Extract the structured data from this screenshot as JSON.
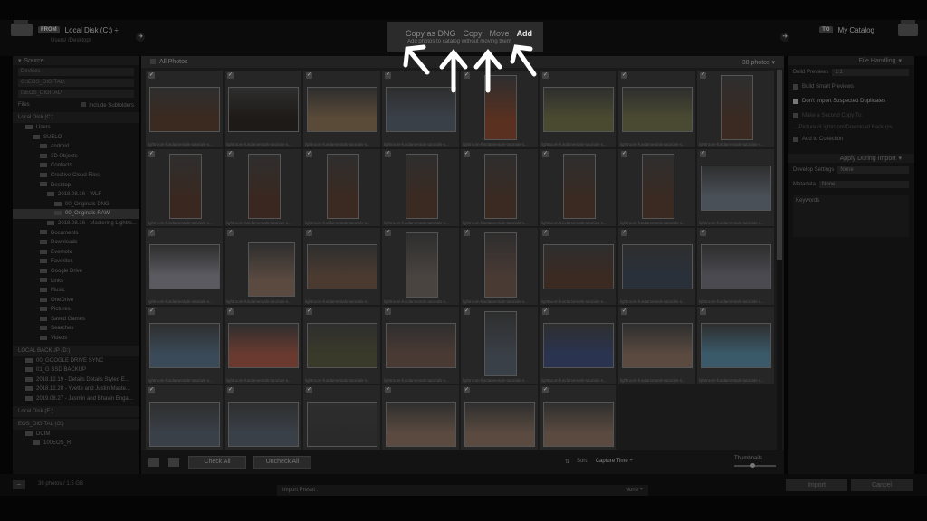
{
  "header": {
    "from_badge": "FROM",
    "from_location": "Local Disk (C:) ÷",
    "from_subpath": "Users/ /Desktop/",
    "import_modes": [
      "Copy as DNG",
      "Copy",
      "Move",
      "Add"
    ],
    "active_mode": "Add",
    "mode_description": "Add photos to catalog without moving them",
    "to_badge": "TO",
    "to_location": "My Catalog"
  },
  "source_panel": {
    "title": "Source",
    "fields": [
      "Devices",
      "G:\\EOS_DIGITAL\\",
      "I:\\EOS_DIGITAL\\"
    ],
    "files_label": "Files",
    "include_subfolders": "Include Subfolders",
    "tree": [
      {
        "label": "Local Disk (C:)",
        "type": "volume"
      },
      {
        "label": "Users",
        "type": "folder",
        "indent": 1
      },
      {
        "label": "SUELO",
        "type": "folder",
        "indent": 2
      },
      {
        "label": "android",
        "type": "folder",
        "indent": 3
      },
      {
        "label": "3D Objects",
        "type": "folder",
        "indent": 3
      },
      {
        "label": "Contacts",
        "type": "folder",
        "indent": 3
      },
      {
        "label": "Creative Cloud Files",
        "type": "folder",
        "indent": 3
      },
      {
        "label": "Desktop",
        "type": "folder",
        "indent": 3
      },
      {
        "label": "2018.08.16 - WLF",
        "type": "folder",
        "indent": 4
      },
      {
        "label": "00_Originals DNG",
        "type": "folder",
        "indent": 5
      },
      {
        "label": "00_Originals RAW",
        "type": "folder",
        "indent": 5,
        "selected": true
      },
      {
        "label": "2018.08.16 - Mastering Lightro...",
        "type": "folder",
        "indent": 4
      },
      {
        "label": "Documents",
        "type": "folder",
        "indent": 3
      },
      {
        "label": "Downloads",
        "type": "folder",
        "indent": 3
      },
      {
        "label": "Evernote",
        "type": "folder",
        "indent": 3
      },
      {
        "label": "Favorites",
        "type": "folder",
        "indent": 3
      },
      {
        "label": "Google Drive",
        "type": "folder",
        "indent": 3
      },
      {
        "label": "Links",
        "type": "folder",
        "indent": 3
      },
      {
        "label": "Music",
        "type": "folder",
        "indent": 3
      },
      {
        "label": "OneDrive",
        "type": "folder",
        "indent": 3
      },
      {
        "label": "Pictures",
        "type": "folder",
        "indent": 3
      },
      {
        "label": "Saved Games",
        "type": "folder",
        "indent": 3
      },
      {
        "label": "Searches",
        "type": "folder",
        "indent": 3
      },
      {
        "label": "Videos",
        "type": "folder",
        "indent": 3
      },
      {
        "label": "LOCAL BACKUP (D:)",
        "type": "volume"
      },
      {
        "label": "00_GOOGLE DRIVE SYNC",
        "type": "folder",
        "indent": 1
      },
      {
        "label": "01_G SSD BACKUP",
        "type": "folder",
        "indent": 1
      },
      {
        "label": "2018.12.19 - Details Details Styled E...",
        "type": "folder",
        "indent": 1
      },
      {
        "label": "2018.12.20 - Yvette and Justin Maste...",
        "type": "folder",
        "indent": 1
      },
      {
        "label": "2019.08.27 - Jasmin and Bhavin Enga...",
        "type": "folder",
        "indent": 1
      },
      {
        "label": "Local Disk (E:)",
        "type": "volume"
      },
      {
        "label": "EOS_DIGITAL (G:)",
        "type": "volume"
      },
      {
        "label": "DCIM",
        "type": "folder",
        "indent": 1
      },
      {
        "label": "100EOS_R",
        "type": "folder",
        "indent": 2
      }
    ]
  },
  "grid": {
    "title": "All Photos",
    "count": "38 photos",
    "caption": "lightroom-fundamentals-tutorials-s...",
    "thumbs": [
      {
        "shape": "l",
        "color": "#3a2a20"
      },
      {
        "shape": "l",
        "color": "#1e1a18"
      },
      {
        "shape": "l",
        "color": "#5a4a38"
      },
      {
        "shape": "l",
        "color": "#3a4048"
      },
      {
        "shape": "p",
        "color": "#5a3020"
      },
      {
        "shape": "l",
        "color": "#4a4a30"
      },
      {
        "shape": "l",
        "color": "#4a4a32"
      },
      {
        "shape": "p",
        "color": "#3a2a22"
      },
      {
        "shape": "p",
        "color": "#3a2820"
      },
      {
        "shape": "p",
        "color": "#3a2820"
      },
      {
        "shape": "p",
        "color": "#3b2a22"
      },
      {
        "shape": "p",
        "color": "#3b2a22"
      },
      {
        "shape": "p",
        "color": "#3a2a22"
      },
      {
        "shape": "p",
        "color": "#3a2a22"
      },
      {
        "shape": "p",
        "color": "#3a2a22"
      },
      {
        "shape": "l",
        "color": "#4a5058"
      },
      {
        "shape": "l",
        "color": "#5a5a60"
      },
      {
        "shape": "pp",
        "color": "#5a4a40"
      },
      {
        "shape": "l",
        "color": "#4a3a30"
      },
      {
        "shape": "p",
        "color": "#4a4440"
      },
      {
        "shape": "p",
        "color": "#4a3a34"
      },
      {
        "shape": "l",
        "color": "#3a2a22"
      },
      {
        "shape": "l",
        "color": "#2a303a"
      },
      {
        "shape": "l",
        "color": "#4a4a50"
      },
      {
        "shape": "l",
        "color": "#3a4a58"
      },
      {
        "shape": "l",
        "color": "#6a3a30"
      },
      {
        "shape": "l",
        "color": "#3a3a2a"
      },
      {
        "shape": "l",
        "color": "#4a3a34"
      },
      {
        "shape": "p",
        "color": "#3a4048"
      },
      {
        "shape": "l",
        "color": "#2a3450"
      },
      {
        "shape": "l",
        "color": "#5a4a40"
      },
      {
        "shape": "l",
        "color": "#3a5a6a"
      },
      {
        "shape": "l",
        "color": "#3a4048"
      },
      {
        "shape": "l",
        "color": "#3a4048"
      },
      {
        "shape": "l",
        "color": "#2a2a2a"
      },
      {
        "shape": "l",
        "color": "#5a4a40"
      },
      {
        "shape": "l",
        "color": "#5a4a40"
      },
      {
        "shape": "l",
        "color": "#5a4a40"
      }
    ]
  },
  "toolbar": {
    "check_all": "Check All",
    "uncheck_all": "Uncheck All",
    "sort_label": "Sort:",
    "sort_value": "Capture Time ÷",
    "thumbnails_label": "Thumbnails"
  },
  "right_panel": {
    "file_handling_title": "File Handling",
    "build_previews_label": "Build Previews",
    "build_previews_value": "1:1",
    "build_smart_previews": "Build Smart Previews",
    "dont_import_duplicates": "Don't Import Suspected Duplicates",
    "second_copy": "Make a Second Copy To:",
    "second_copy_path": "...\\Pictures\\Lightroom\\Download Backups",
    "add_to_collection": "Add to Collection",
    "apply_title": "Apply During Import",
    "develop_settings_label": "Develop Settings",
    "develop_settings_value": "None",
    "metadata_label": "Metadata",
    "metadata_value": "None",
    "keywords_label": "Keywords"
  },
  "bottom": {
    "minus": "−",
    "selected_count": "38 photos / 1.5 GB",
    "import_preset_label": "Import Preset :",
    "import_preset_value": "None ÷",
    "import_button": "Import",
    "cancel_button": "Cancel"
  }
}
